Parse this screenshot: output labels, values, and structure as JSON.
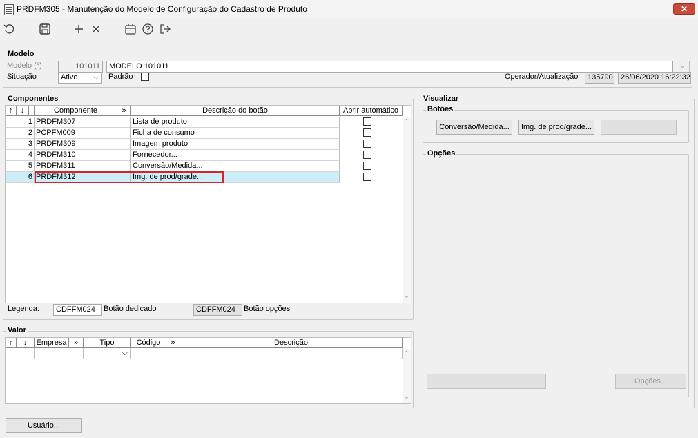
{
  "window": {
    "title": "PRDFM305 - Manutenção do Modelo de Configuração do Cadastro de Produto",
    "close_label": "✕"
  },
  "toolbar": {
    "icons": [
      "undo-icon",
      "save-icon",
      "add-icon",
      "delete-icon",
      "calendar-icon",
      "help-icon",
      "exit-icon"
    ]
  },
  "modelo": {
    "section_title": "Modelo",
    "modelo_label": "Modelo (*)",
    "modelo_code": "101011",
    "modelo_name": "MODELO 101011",
    "situacao_label": "Situação",
    "situacao_value": "Ativo",
    "padrao_label": "Padrão",
    "operador_label": "Operador/Atualização",
    "operador_value": "135790",
    "atualizacao_value": "26/06/2020 16:22:32"
  },
  "componentes": {
    "section_title": "Componentes",
    "headers": {
      "up": "↑",
      "down": "↓",
      "componente": "Componente",
      "expand": "»",
      "descricao": "Descrição do botão",
      "abrir": "Abrir automático"
    },
    "rows": [
      {
        "n": "1",
        "componente": "PRDFM307",
        "descricao": "Lista de produto"
      },
      {
        "n": "2",
        "componente": "PCPFM009",
        "descricao": "Ficha de consumo"
      },
      {
        "n": "3",
        "componente": "PRDFM309",
        "descricao": "Imagem produto"
      },
      {
        "n": "4",
        "componente": "PRDFM310",
        "descricao": "Fornecedor..."
      },
      {
        "n": "5",
        "componente": "PRDFM311",
        "descricao": "Conversão/Medida..."
      },
      {
        "n": "6",
        "componente": "PRDFM312",
        "descricao": "Img. de prod/grade..."
      }
    ],
    "legenda_label": "Legenda:",
    "legenda_dedicado_code": "CDFFM024",
    "legenda_dedicado_label": "Botão dedicado",
    "legenda_opcoes_code": "CDFFM024",
    "legenda_opcoes_label": "Botão opções"
  },
  "valor": {
    "section_title": "Valor",
    "headers": {
      "up": "↑",
      "down": "↓",
      "empresa": "Empresa",
      "expand1": "»",
      "tipo": "Tipo",
      "codigo": "Código",
      "expand2": "»",
      "descricao": "Descrição"
    }
  },
  "visualizar": {
    "section_title": "Visualizar",
    "botoes_title": "Botões",
    "btn1": "Conversão/Medida...",
    "btn2": "Img. de prod/grade...",
    "btn3": "",
    "opcoes_title": "Opções",
    "opcoes_button": "Opções...",
    "opcoes_left_button": ""
  },
  "footer": {
    "usuario_button": "Usuário..."
  },
  "colors": {
    "selected_row": "#cdeef8",
    "highlight_box": "#d9232b",
    "close_button": "#c94b3b"
  }
}
